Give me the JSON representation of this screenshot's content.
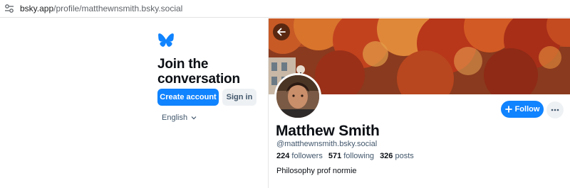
{
  "browser": {
    "url_domain": "bsky.app",
    "url_path": "/profile/matthewnsmith.bsky.social"
  },
  "signup": {
    "title": "Join the conversation",
    "create_account_label": "Create account",
    "sign_in_label": "Sign in",
    "language": "English"
  },
  "profile": {
    "display_name": "Matthew Smith",
    "handle": "@matthewnsmith.bsky.social",
    "followers_count": "224",
    "followers_label": "followers",
    "following_count": "571",
    "following_label": "following",
    "posts_count": "326",
    "posts_label": "posts",
    "bio": "Philosophy prof normie",
    "follow_label": "Follow"
  },
  "colors": {
    "accent": "#1083fe",
    "text_primary": "#0b0f14",
    "text_secondary": "#42576c"
  }
}
